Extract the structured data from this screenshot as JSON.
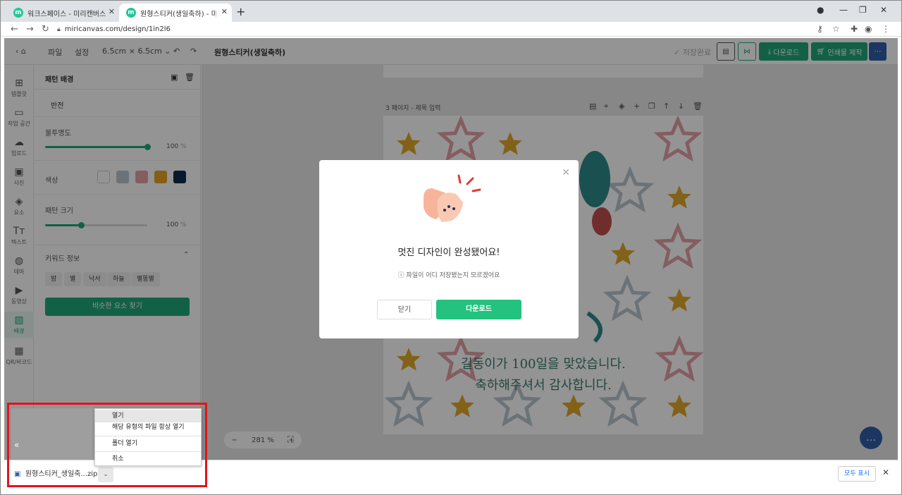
{
  "browser": {
    "tabs": [
      {
        "favicon": "m",
        "title": "워크스페이스 - 미리캔버스"
      },
      {
        "favicon": "m",
        "title": "원형스티커(생일축하) - 미리캔버스"
      }
    ],
    "url": "miricanvas.com/design/1in2l6"
  },
  "header": {
    "menu_file": "파일",
    "menu_settings": "설정",
    "size": "6.5cm × 6.5cm",
    "title": "원형스티커(생일축하)",
    "save_status": "저장완료",
    "download_label": "다운로드",
    "print_label": "인쇄물 제작"
  },
  "rail": {
    "items": [
      {
        "icon": "template-icon",
        "glyph": "⊞",
        "label": "템플릿"
      },
      {
        "icon": "workspace-icon",
        "glyph": "▭",
        "label": "작업 공간"
      },
      {
        "icon": "upload-icon",
        "glyph": "☁",
        "label": "업로드"
      },
      {
        "icon": "photo-icon",
        "glyph": "▣",
        "label": "사진"
      },
      {
        "icon": "element-icon",
        "glyph": "◈",
        "label": "요소"
      },
      {
        "icon": "text-icon",
        "glyph": "Tт",
        "label": "텍스트"
      },
      {
        "icon": "theme-icon",
        "glyph": "◍",
        "label": "테마"
      },
      {
        "icon": "video-icon",
        "glyph": "▶",
        "label": "동영상"
      },
      {
        "icon": "background-icon",
        "glyph": "▨",
        "label": "배경"
      },
      {
        "icon": "qr-icon",
        "glyph": "▦",
        "label": "QR/바코드"
      }
    ]
  },
  "panel": {
    "title": "패턴 배경",
    "invert": "반전",
    "opacity_label": "불투명도",
    "opacity_value": "100",
    "opacity_unit": "%",
    "opacity_fraction": 1.0,
    "color_label": "색상",
    "colors": [
      "#ffffff",
      "#b8c6cf",
      "#e4a1a7",
      "#e3a424",
      "#0f2b4a"
    ],
    "pattern_size_label": "패턴 크기",
    "pattern_size_value": "100",
    "pattern_size_unit": "%",
    "pattern_size_fraction": 0.35,
    "keyword_label": "키워드 정보",
    "keywords": [
      "밤",
      "별",
      "낙서",
      "하늘",
      "별똥별"
    ],
    "find_similar": "비슷한 요소 찾기"
  },
  "canvas": {
    "page_label": "3 페이지 - 제목 입력",
    "text_line1": "길동이가 100일을 맞았습니다.",
    "text_line2": "축하해주셔서 감사합니다.",
    "zoom_value": "281",
    "zoom_unit": "%"
  },
  "dialog": {
    "title": "멋진 디자인이 완성됐어요!",
    "help": "파일이 어디 저장됐는지 모르겠어요",
    "cancel": "닫기",
    "download": "다운로드"
  },
  "download_shelf": {
    "filename": "원형스티커_생일축...zip",
    "show_all": "모두 표시"
  },
  "context_menu": {
    "items": [
      "열기",
      "해당 유형의 파일 항상 열기",
      "폴더 열기",
      "취소"
    ]
  }
}
